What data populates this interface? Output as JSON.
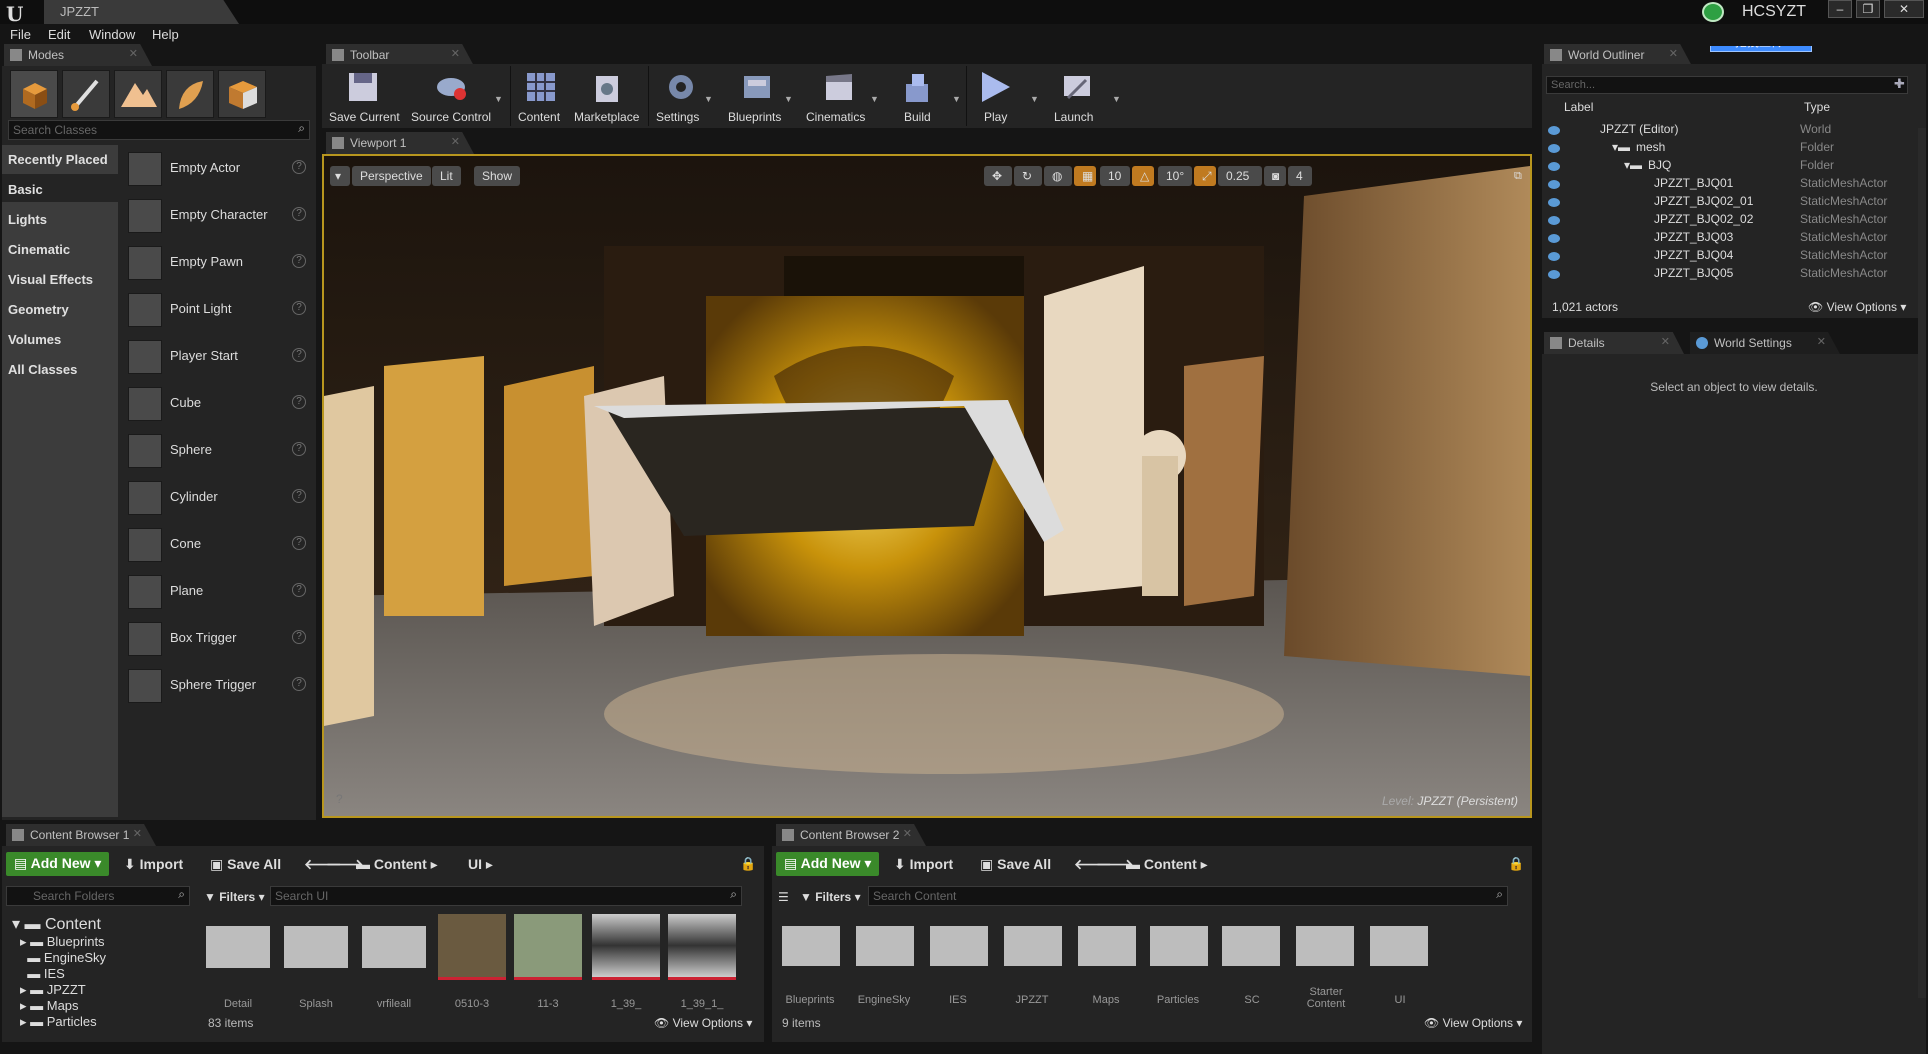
{
  "window": {
    "title": "JPZZT",
    "user": "HCSYZT",
    "cloud_button": "拖拽上传"
  },
  "menu": [
    "File",
    "Edit",
    "Window",
    "Help"
  ],
  "modes": {
    "tab": "Modes",
    "search_placeholder": "Search Classes",
    "categories": [
      "Recently Placed",
      "Basic",
      "Lights",
      "Cinematic",
      "Visual Effects",
      "Geometry",
      "Volumes",
      "All Classes"
    ],
    "selected_category": "Basic",
    "actors": [
      "Empty Actor",
      "Empty Character",
      "Empty Pawn",
      "Point Light",
      "Player Start",
      "Cube",
      "Sphere",
      "Cylinder",
      "Cone",
      "Plane",
      "Box Trigger",
      "Sphere Trigger"
    ]
  },
  "toolbar": {
    "tab": "Toolbar",
    "buttons": [
      "Save Current",
      "Source Control",
      "Content",
      "Marketplace",
      "Settings",
      "Blueprints",
      "Cinematics",
      "Build",
      "Play",
      "Launch"
    ]
  },
  "viewport": {
    "tab": "Viewport 1",
    "perspective": "Perspective",
    "lit": "Lit",
    "show": "Show",
    "grid_snap": "10",
    "rot_snap": "10°",
    "scale_snap": "0.25",
    "camera_speed": "4",
    "level_prefix": "Level:",
    "level_name": "JPZZT (Persistent)"
  },
  "outliner": {
    "tab": "World Outliner",
    "search_placeholder": "Search...",
    "col_label": "Label",
    "col_type": "Type",
    "rows": [
      {
        "label": "JPZZT (Editor)",
        "type": "World",
        "indent": 0
      },
      {
        "label": "mesh",
        "type": "Folder",
        "indent": 1
      },
      {
        "label": "BJQ",
        "type": "Folder",
        "indent": 2
      },
      {
        "label": "JPZZT_BJQ01",
        "type": "StaticMeshActor",
        "indent": 3
      },
      {
        "label": "JPZZT_BJQ02_01",
        "type": "StaticMeshActor",
        "indent": 3
      },
      {
        "label": "JPZZT_BJQ02_02",
        "type": "StaticMeshActor",
        "indent": 3
      },
      {
        "label": "JPZZT_BJQ03",
        "type": "StaticMeshActor",
        "indent": 3
      },
      {
        "label": "JPZZT_BJQ04",
        "type": "StaticMeshActor",
        "indent": 3
      },
      {
        "label": "JPZZT_BJQ05",
        "type": "StaticMeshActor",
        "indent": 3
      }
    ],
    "actor_count": "1,021 actors",
    "view_options": "View Options"
  },
  "details": {
    "tab": "Details",
    "tab2": "World Settings",
    "message": "Select an object to view details."
  },
  "content_browser_1": {
    "tab": "Content Browser 1",
    "add_new": "Add New",
    "import": "Import",
    "save_all": "Save All",
    "path": [
      "Content",
      "UI"
    ],
    "search_folders": "Search Folders",
    "filters": "Filters",
    "search_placeholder": "Search UI",
    "tree_root": "Content",
    "tree": [
      "Blueprints",
      "EngineSky",
      "IES",
      "JPZZT",
      "Maps",
      "Particles"
    ],
    "assets": [
      "Detail",
      "Splash",
      "vrfileall",
      "0510-3",
      "11-3",
      "1_39_",
      "1_39_1_"
    ],
    "item_count": "83 items",
    "view_options": "View Options"
  },
  "content_browser_2": {
    "tab": "Content Browser 2",
    "add_new": "Add New",
    "import": "Import",
    "save_all": "Save All",
    "path": [
      "Content"
    ],
    "filters": "Filters",
    "search_placeholder": "Search Content",
    "assets": [
      "Blueprints",
      "EngineSky",
      "IES",
      "JPZZT",
      "Maps",
      "Particles",
      "SC",
      "Starter Content",
      "UI"
    ],
    "item_count": "9 items",
    "view_options": "View Options"
  }
}
